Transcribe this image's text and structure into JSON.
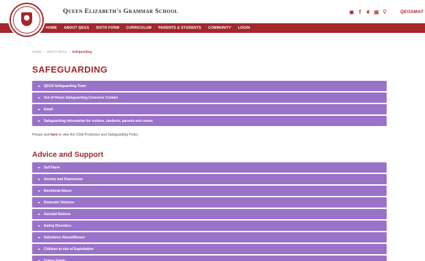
{
  "header": {
    "school_name": "Queen Elizabeth's Grammar School",
    "social_icons": [
      {
        "icon": "instagram-icon",
        "glyph": "▣"
      },
      {
        "icon": "facebook-icon",
        "glyph": "f"
      },
      {
        "icon": "twitter-icon",
        "glyph": "❦"
      },
      {
        "icon": "calendar-icon",
        "glyph": "▦"
      },
      {
        "icon": "search-icon",
        "glyph": "⚲"
      }
    ],
    "right_link": "QEGSMAT"
  },
  "nav": {
    "items": [
      "HOME",
      "ABOUT QEGS",
      "SIXTH FORM",
      "CURRICULUM",
      "PARENTS & STUDENTS",
      "COMMUNITY",
      "LOGIN"
    ]
  },
  "breadcrumb": {
    "items": [
      "HOME",
      "ABOUT QEGS"
    ],
    "separator": "›",
    "current": "Safeguarding"
  },
  "page": {
    "title": "SAFEGUARDING",
    "visit_prefix": "Please visit ",
    "visit_link": "here",
    "visit_suffix": " to view the Child Protection and Safeguarding Policy"
  },
  "safeguarding_accordion": [
    "QEGS Safeguarding Team",
    "Out of Hours Safeguarding Concerns Contact",
    "Email",
    "Safeguarding information for visitors, students, parents and carers"
  ],
  "advice": {
    "title": "Advice and Support",
    "items": [
      "Self Harm",
      "Anxiety and Depression",
      "Emotional Abuse",
      "Domestic Violence",
      "Suicidal Notions",
      "Eating Disorders",
      "Substance Abuse/Misuse",
      "Children at risk of Exploitation",
      "Online Safety"
    ]
  },
  "colors": {
    "brand": "#a3272b",
    "accordion": "#9a72c8"
  }
}
